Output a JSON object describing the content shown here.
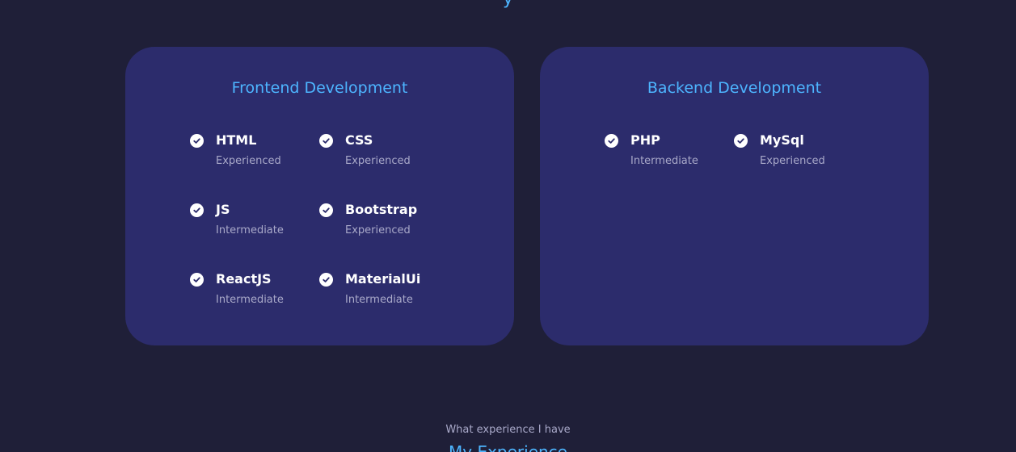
{
  "colors": {
    "background": "#1f1f38",
    "card": "#2c2c6c",
    "accent": "#4db5ff",
    "text": "#ffffff",
    "muted": "#a9a9c9"
  },
  "top_heading_clipped": "y",
  "frontend": {
    "title": "Frontend Development",
    "skills": [
      {
        "name": "HTML",
        "level": "Experienced",
        "icon": "check-badge-icon"
      },
      {
        "name": "CSS",
        "level": "Experienced",
        "icon": "check-badge-icon"
      },
      {
        "name": "JS",
        "level": "Intermediate",
        "icon": "check-badge-icon"
      },
      {
        "name": "Bootstrap",
        "level": "Experienced",
        "icon": "check-badge-icon"
      },
      {
        "name": "ReactJS",
        "level": "Intermediate",
        "icon": "check-badge-icon"
      },
      {
        "name": "MaterialUi",
        "level": "Intermediate",
        "icon": "check-badge-icon"
      }
    ]
  },
  "backend": {
    "title": "Backend Development",
    "skills": [
      {
        "name": "PHP",
        "level": "Intermediate",
        "icon": "check-badge-icon"
      },
      {
        "name": "MySql",
        "level": "Experienced",
        "icon": "check-badge-icon"
      }
    ]
  },
  "experience_section": {
    "subtitle": "What experience I have",
    "title": "My Experience"
  }
}
